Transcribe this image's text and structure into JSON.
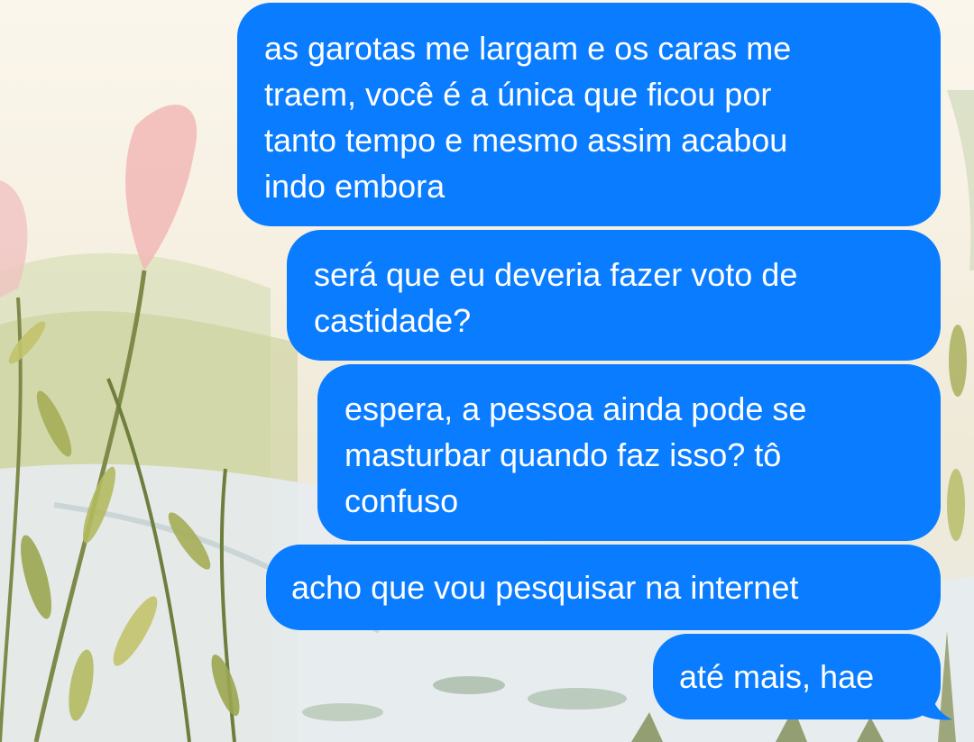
{
  "conversation": {
    "messages": [
      {
        "sender": "self",
        "text": "as garotas me largam e os caras me\ntraem, você é a única que ficou por\ntanto tempo e mesmo assim acabou\nindo embora"
      },
      {
        "sender": "self",
        "text": "será que eu deveria fazer voto de\ncastidade?"
      },
      {
        "sender": "self",
        "text": "espera, a pessoa ainda pode se\nmasturbar quando faz isso? tô\nconfuso"
      },
      {
        "sender": "self",
        "text": "acho que vou pesquisar na internet"
      },
      {
        "sender": "self",
        "text": "até mais, hae"
      }
    ]
  },
  "theme": {
    "bubble_color": "#0a7cff",
    "text_color": "#ffffff",
    "wallpaper": "pastel watercolor pond with reeds and pink flowers"
  }
}
